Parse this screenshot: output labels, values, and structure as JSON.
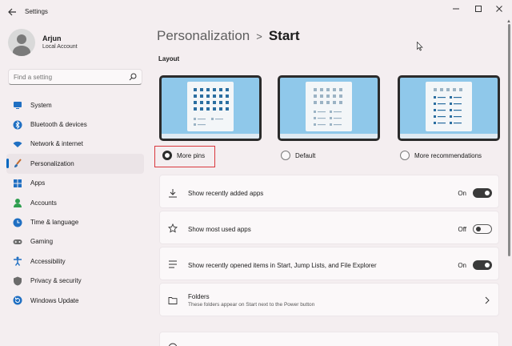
{
  "window": {
    "title": "Settings"
  },
  "user": {
    "name": "Arjun",
    "account": "Local Account"
  },
  "search": {
    "placeholder": "Find a setting"
  },
  "sidebar": {
    "items": [
      {
        "label": "System",
        "icon": "monitor-icon",
        "color": "#1f6fc2"
      },
      {
        "label": "Bluetooth & devices",
        "icon": "bluetooth-icon",
        "color": "#1f6fc2"
      },
      {
        "label": "Network & internet",
        "icon": "wifi-icon",
        "color": "#1f6fc2"
      },
      {
        "label": "Personalization",
        "icon": "brush-icon",
        "color": "#c46a2b",
        "active": true
      },
      {
        "label": "Apps",
        "icon": "apps-icon",
        "color": "#1f6fc2"
      },
      {
        "label": "Accounts",
        "icon": "person-icon",
        "color": "#2f9e4f"
      },
      {
        "label": "Time & language",
        "icon": "globe-clock-icon",
        "color": "#1f6fc2"
      },
      {
        "label": "Gaming",
        "icon": "gamepad-icon",
        "color": "#6b6b6b"
      },
      {
        "label": "Accessibility",
        "icon": "accessibility-icon",
        "color": "#1f6fc2"
      },
      {
        "label": "Privacy & security",
        "icon": "shield-icon",
        "color": "#6b6b6b"
      },
      {
        "label": "Windows Update",
        "icon": "update-icon",
        "color": "#1f6fc2"
      }
    ]
  },
  "breadcrumb": {
    "parent": "Personalization",
    "separator": ">",
    "current": "Start"
  },
  "layout": {
    "label": "Layout",
    "options": [
      {
        "label": "More pins",
        "selected": true
      },
      {
        "label": "Default",
        "selected": false
      },
      {
        "label": "More recommendations",
        "selected": false
      }
    ]
  },
  "settings": [
    {
      "title": "Show recently added apps",
      "state": "On",
      "on": true,
      "icon": "download-icon"
    },
    {
      "title": "Show most used apps",
      "state": "Off",
      "on": false,
      "icon": "star-icon"
    },
    {
      "title": "Show recently opened items in Start, Jump Lists, and File Explorer",
      "state": "On",
      "on": true,
      "icon": "list-icon"
    }
  ],
  "folders": {
    "title": "Folders",
    "subtitle": "These folders appear on Start next to the Power button",
    "icon": "folder-icon"
  }
}
